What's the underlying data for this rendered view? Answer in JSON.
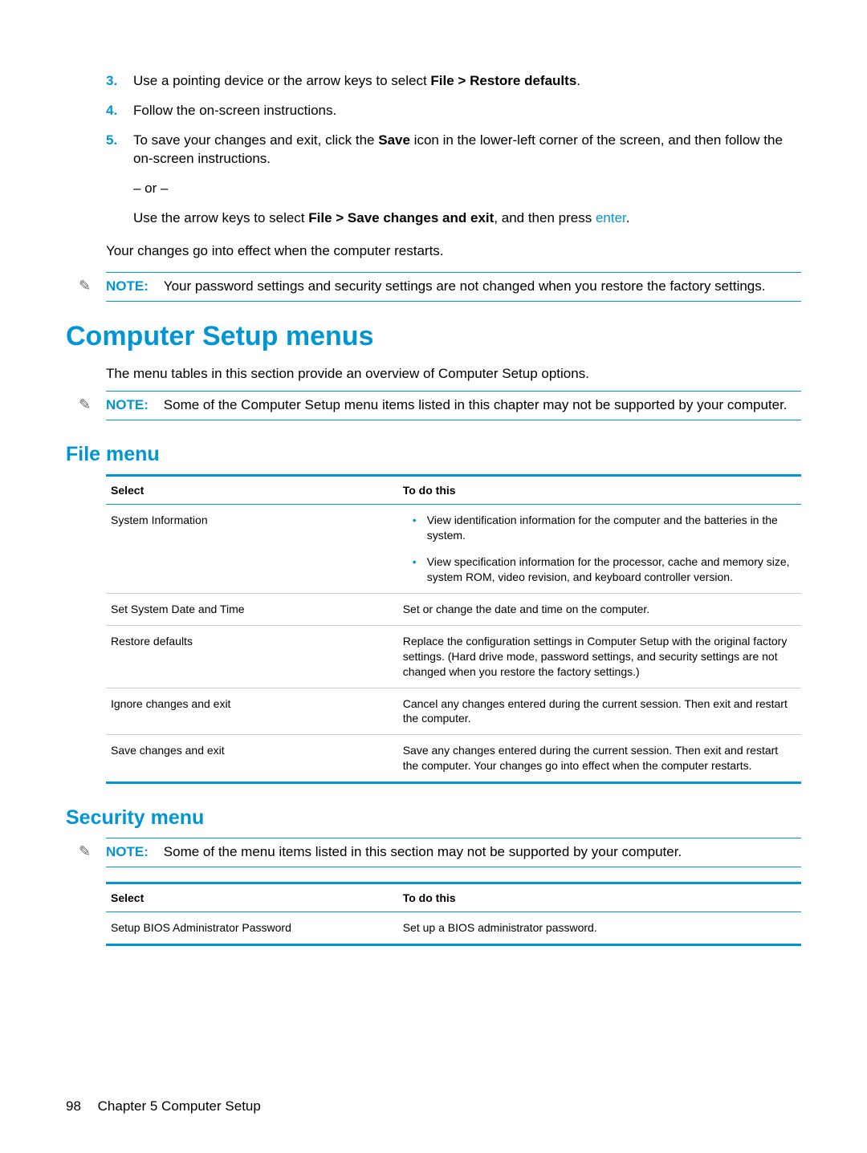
{
  "steps": [
    {
      "num": "3.",
      "pre": "Use a pointing device or the arrow keys to select ",
      "bold": "File > Restore defaults",
      "post": "."
    },
    {
      "num": "4.",
      "text": "Follow the on-screen instructions."
    },
    {
      "num": "5.",
      "line1a": "To save your changes and exit, click the ",
      "line1b": "Save",
      "line1c": " icon in the lower-left corner of the screen, and then follow the on-screen instructions.",
      "or": "– or –",
      "line2a": "Use the arrow keys to select ",
      "line2b": "File > Save changes and exit",
      "line2c": ", and then press ",
      "enter": "enter",
      "line2d": "."
    }
  ],
  "afterList": "Your changes go into effect when the computer restarts.",
  "note1": {
    "label": "NOTE:",
    "text": "Your password settings and security settings are not changed when you restore the factory settings."
  },
  "h1": "Computer Setup menus",
  "intro": "The menu tables in this section provide an overview of Computer Setup options.",
  "note2": {
    "label": "NOTE:",
    "text": "Some of the Computer Setup menu items listed in this chapter may not be supported by your computer."
  },
  "fileHeading": "File menu",
  "tableHeaders": {
    "select": "Select",
    "todo": "To do this"
  },
  "fileRows": [
    {
      "select": "System Information",
      "bullets": [
        "View identification information for the computer and the batteries in the system.",
        "View specification information for the processor, cache and memory size, system ROM, video revision, and keyboard controller version."
      ]
    },
    {
      "select": "Set System Date and Time",
      "todo": "Set or change the date and time on the computer."
    },
    {
      "select": "Restore defaults",
      "todo": "Replace the configuration settings in Computer Setup with the original factory settings. (Hard drive mode, password settings, and security settings are not changed when you restore the factory settings.)"
    },
    {
      "select": "Ignore changes and exit",
      "todo": "Cancel any changes entered during the current session. Then exit and restart the computer."
    },
    {
      "select": "Save changes and exit",
      "todo": "Save any changes entered during the current session. Then exit and restart the computer. Your changes go into effect when the computer restarts."
    }
  ],
  "securityHeading": "Security menu",
  "note3": {
    "label": "NOTE:",
    "text": "Some of the menu items listed in this section may not be supported by your computer."
  },
  "secRows": [
    {
      "select": "Setup BIOS Administrator Password",
      "todo": "Set up a BIOS administrator password."
    }
  ],
  "footer": {
    "page": "98",
    "chapter": "Chapter 5   Computer Setup"
  }
}
